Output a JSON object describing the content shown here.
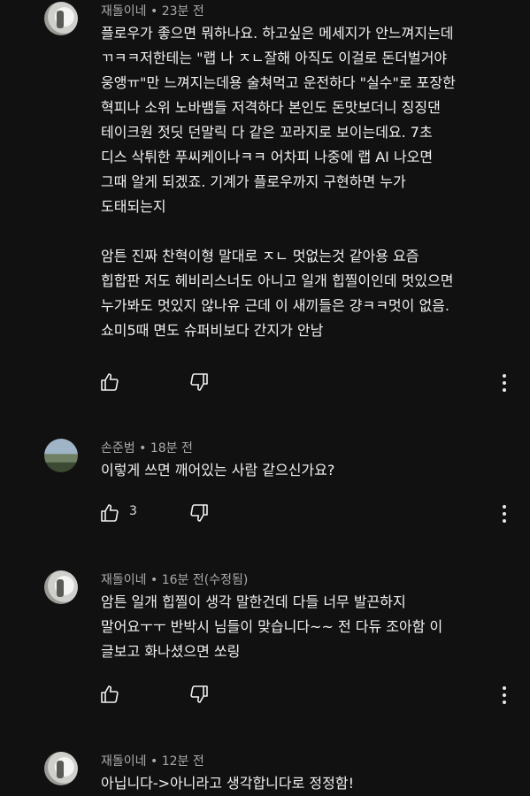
{
  "comments": [
    {
      "author": "재돌이네",
      "time": "23분 전",
      "lines": [
        "플로우가 좋으면 뭐하나요. 하고싶은 메세지가 안느껴지는데",
        "ㄲㅋㅋ저한테는 \"랩 나 ㅈㄴ잘해 아직도 이걸로 돈더벌거야",
        "웅앵ㅠ\"만 느껴지는데용 술쳐먹고 운전하다 \"실수\"로 포장한",
        "혁피나 소위 노바뱀들 저격하다 본인도 돈맛보더니 징징댄",
        "테이크원 젓딧 던말릭 다 같은 꼬라지로 보이는데요. 7초",
        "디스 삭튀한 푸씨케이나ㅋㅋ 어차피 나중에 랩 AI 나오면",
        "그때 알게 되겠죠. 기계가 플로우까지 구현하면 누가",
        "도태되는지",
        "",
        "암튼 진짜 찬혁이형 말대로 ㅈㄴ 멋없는것 같아용 요즘",
        "힙합판 저도 헤비리스너도 아니고 일개 힙찔이인데 멋있으면",
        "누가봐도 멋있지 않나유 근데 이 새끼들은 걍ㅋㅋ멋이 없음.",
        "쇼미5때 면도 슈퍼비보다 간지가 안남"
      ],
      "likes": ""
    },
    {
      "author": "손준범",
      "time": "18분 전",
      "lines": [
        "이렇게 쓰면 깨어있는 사람 같으신가요?"
      ],
      "likes": "3"
    },
    {
      "author": "재돌이네",
      "time": "16분 전(수정됨)",
      "lines": [
        "암튼 일개 힙찔이 생각 말한건데 다들 너무 발끈하지",
        "말어요ㅜㅜ 반박시 님들이 맞습니다~~  전 다듀 조아함 이",
        "글보고 화나셨으면 쏘링"
      ],
      "likes": ""
    },
    {
      "author": "재돌이네",
      "time": "12분 전",
      "lines": [
        "아닙니다->아니라고 생각합니다로 정정함!"
      ],
      "likes": ""
    }
  ],
  "separator": " • ",
  "icons": {
    "like": "thumbs-up-icon",
    "dislike": "thumbs-down-icon",
    "more": "more-vert-icon"
  }
}
